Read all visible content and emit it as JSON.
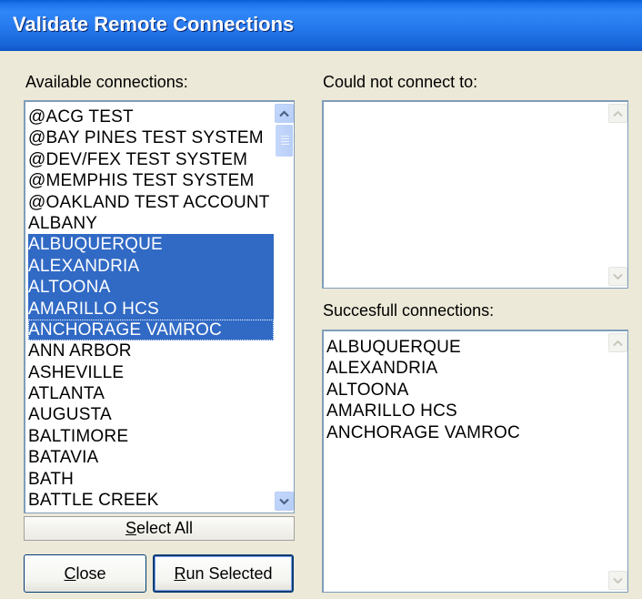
{
  "window": {
    "title": "Validate Remote Connections"
  },
  "available": {
    "label": "Available connections:",
    "items": [
      {
        "text": "@ACG TEST",
        "selected": false
      },
      {
        "text": "@BAY PINES TEST SYSTEM",
        "selected": false
      },
      {
        "text": "@DEV/FEX TEST SYSTEM",
        "selected": false
      },
      {
        "text": "@MEMPHIS TEST SYSTEM",
        "selected": false
      },
      {
        "text": "@OAKLAND TEST ACCOUNT",
        "selected": false
      },
      {
        "text": "ALBANY",
        "selected": false
      },
      {
        "text": "ALBUQUERQUE",
        "selected": true
      },
      {
        "text": "ALEXANDRIA",
        "selected": true
      },
      {
        "text": "ALTOONA",
        "selected": true
      },
      {
        "text": "AMARILLO HCS",
        "selected": true
      },
      {
        "text": "ANCHORAGE VAMROC",
        "selected": true
      },
      {
        "text": "ANN ARBOR",
        "selected": false
      },
      {
        "text": "ASHEVILLE",
        "selected": false
      },
      {
        "text": "ATLANTA",
        "selected": false
      },
      {
        "text": "AUGUSTA",
        "selected": false
      },
      {
        "text": "BALTIMORE",
        "selected": false
      },
      {
        "text": "BATAVIA",
        "selected": false
      },
      {
        "text": "BATH",
        "selected": false
      },
      {
        "text": "BATTLE CREEK",
        "selected": false
      }
    ]
  },
  "failed": {
    "label": "Could not connect to:",
    "items": []
  },
  "success": {
    "label": "Succesfull connections:",
    "items": [
      "ALBUQUERQUE",
      "ALEXANDRIA",
      "ALTOONA",
      "AMARILLO HCS",
      "ANCHORAGE VAMROC"
    ]
  },
  "buttons": {
    "select_all": {
      "accel": "S",
      "rest": "elect All"
    },
    "close": {
      "accel": "C",
      "rest": "lose"
    },
    "run_selected": {
      "accel": "R",
      "rest": "un Selected"
    }
  },
  "colors": {
    "selection": "#316ac5",
    "titlebar": "#2a7ef0",
    "face": "#ece9d8"
  },
  "icons": {
    "scroll_up": "up-arrow-icon",
    "scroll_down": "down-arrow-icon"
  }
}
